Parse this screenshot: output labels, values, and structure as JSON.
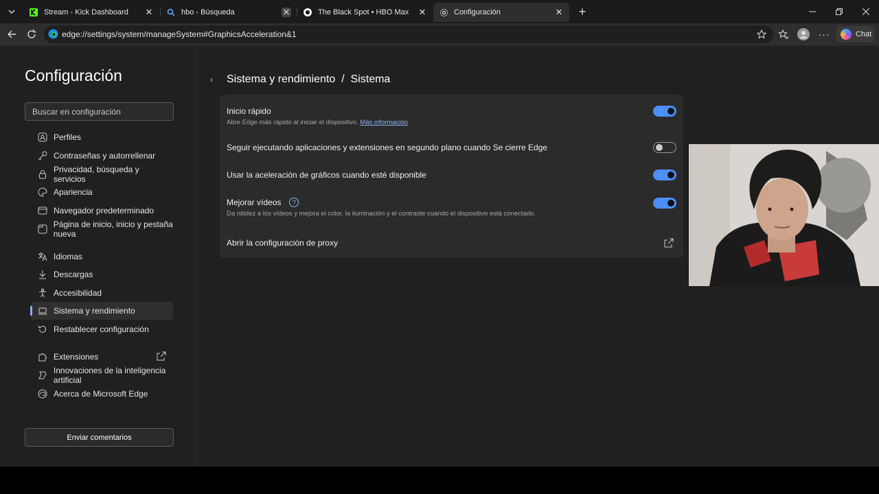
{
  "tabs": [
    {
      "title": "Stream - Kick Dashboard",
      "icon": "kick-icon"
    },
    {
      "title": "hbo - Búsqueda",
      "icon": "search-icon"
    },
    {
      "title": "The Black Spot • HBO Max",
      "icon": "hbo-icon"
    },
    {
      "title": "Configuración",
      "icon": "gear-icon",
      "active": true
    }
  ],
  "address_bar": {
    "url": "edge://settings/system/manageSystem#GraphicsAcceleration&1"
  },
  "toolbar": {
    "chat_label": "Chat"
  },
  "sidebar": {
    "title": "Configuración",
    "search_placeholder": "Buscar en configuración",
    "items": [
      {
        "label": "Perfiles",
        "icon": "profile-icon"
      },
      {
        "label": "Contraseñas y autorrellenar",
        "icon": "key-icon"
      },
      {
        "label": "Privacidad, búsqueda y servicios",
        "icon": "lock-icon"
      },
      {
        "label": "Apariencia",
        "icon": "palette-icon"
      },
      {
        "label": "Navegador predeterminado",
        "icon": "browser-icon"
      },
      {
        "label": "Página de inicio, inicio y pestaña nueva",
        "icon": "home-tab-icon"
      },
      {
        "label": "Idiomas",
        "icon": "language-icon"
      },
      {
        "label": "Descargas",
        "icon": "download-icon"
      },
      {
        "label": "Accesibilidad",
        "icon": "accessibility-icon"
      },
      {
        "label": "Sistema y rendimiento",
        "icon": "laptop-icon",
        "selected": true
      },
      {
        "label": "Restablecer configuración",
        "icon": "reset-icon"
      },
      {
        "label": "Extensiones",
        "icon": "puzzle-icon"
      },
      {
        "label": "Innovaciones de la inteligencia artificial",
        "icon": "ai-icon"
      },
      {
        "label": "Acerca de Microsoft Edge",
        "icon": "edge-icon"
      }
    ],
    "feedback_label": "Enviar comentarios"
  },
  "main": {
    "breadcrumb": "Sistema y rendimiento  /  Sistema",
    "settings": [
      {
        "label": "Inicio rápido",
        "desc": "Abre Edge más rápido al iniciar el dispositivo.",
        "link": "Más información",
        "enabled": true
      },
      {
        "label": "Seguir ejecutando aplicaciones y extensiones en segundo plano cuando Se cierre Edge",
        "enabled": false
      },
      {
        "label": "Usar la aceleración de gráficos cuando esté disponible",
        "enabled": true
      },
      {
        "label": "Mejorar vídeos",
        "desc": "Da nitidez a los vídeos y mejora el color, la iluminación y el contraste cuando el dispositivo está conectado.",
        "enabled": true
      },
      {
        "label": "Abrir la configuración de proxy"
      }
    ]
  },
  "colors": {
    "accent": "#4d8ef7",
    "link": "#8ab4f8",
    "background": "#202020",
    "card": "#2b2b2b"
  }
}
